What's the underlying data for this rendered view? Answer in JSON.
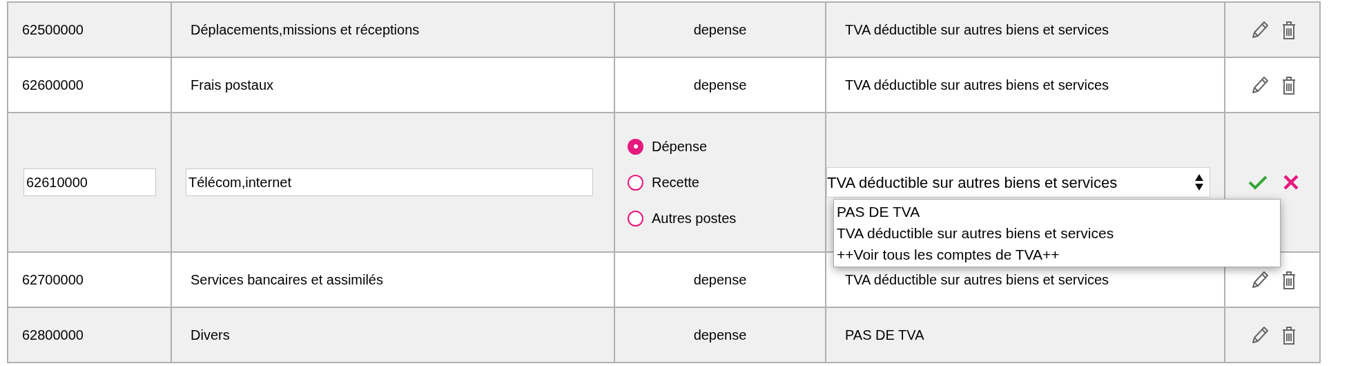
{
  "rows": [
    {
      "kind": "view",
      "code": "62500000",
      "name": "Déplacements,missions et réceptions",
      "type": "depense",
      "tva": "TVA déductible sur autres biens et services"
    },
    {
      "kind": "view",
      "code": "62600000",
      "name": "Frais postaux",
      "type": "depense",
      "tva": "TVA déductible sur autres biens et services"
    },
    {
      "kind": "edit",
      "code": "62610000",
      "name": "Télécom,internet",
      "types": [
        {
          "label": "Dépense",
          "selected": true
        },
        {
          "label": "Recette",
          "selected": false
        },
        {
          "label": "Autres postes",
          "selected": false
        }
      ],
      "tva": {
        "value": "TVA déductible sur autres biens et services",
        "expanded": true,
        "options": [
          "PAS DE TVA",
          "TVA déductible sur autres biens et services",
          "++Voir tous les comptes de TVA++"
        ]
      }
    },
    {
      "kind": "view",
      "code": "62700000",
      "name": "Services bancaires et assimilés",
      "type": "depense",
      "tva": "TVA déductible sur autres biens et services"
    },
    {
      "kind": "view",
      "code": "62800000",
      "name": "Divers",
      "type": "depense",
      "tva": "PAS DE TVA"
    }
  ]
}
